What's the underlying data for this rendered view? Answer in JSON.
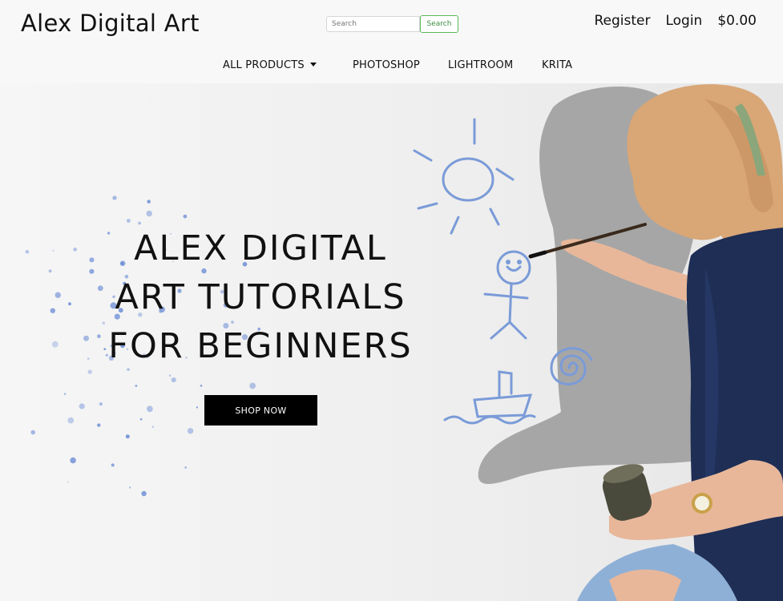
{
  "header": {
    "brand": "Alex Digital Art",
    "search": {
      "placeholder": "Search",
      "button_label": "Search"
    },
    "account": {
      "register": "Register",
      "login": "Login",
      "cart_total": "$0.00"
    }
  },
  "nav": {
    "items": [
      {
        "label": "ALL PRODUCTS",
        "has_dropdown": true
      },
      {
        "label": "PHOTOSHOP"
      },
      {
        "label": "LIGHTROOM"
      },
      {
        "label": "KRITA"
      }
    ]
  },
  "hero": {
    "title_lines": [
      "ALEX DIGITAL",
      "ART TUTORIALS",
      "FOR BEGINNERS"
    ],
    "cta_label": "SHOP NOW",
    "colors": {
      "doodle": "#7a9bd8",
      "splatter": "#6f8fd6",
      "shirt": "#1e2e55",
      "hair": "#d9a676"
    }
  }
}
